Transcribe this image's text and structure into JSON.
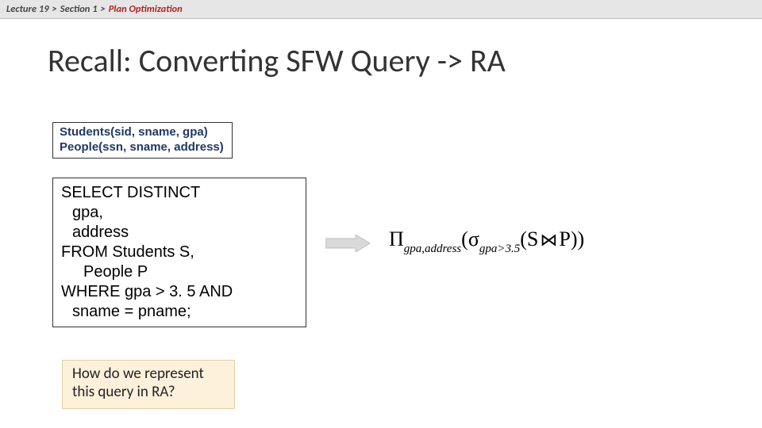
{
  "breadcrumb": {
    "part1": "Lecture 19",
    "sep1": ">",
    "part2": "Section 1",
    "sep2": ">",
    "active": "Plan Optimization"
  },
  "title": "Recall: Converting SFW Query -> RA",
  "schema": {
    "line1": "Students(sid, sname, gpa)",
    "line2": "People(ssn, sname, address)"
  },
  "sql": {
    "l1": "SELECT DISTINCT",
    "l2": "gpa,",
    "l3": "address",
    "l4": "FROM Students S,",
    "l5": "People P",
    "l6": "WHERE gpa > 3. 5 AND",
    "l7": "sname = pname;"
  },
  "question": "How do we represent this query in RA?",
  "ra": {
    "pi": "Π",
    "pi_sub": "gpa,address",
    "lparen1": "(",
    "sigma": "σ",
    "sigma_sub": "gpa>3.5",
    "lparen2": "(",
    "s": "S",
    "join": "⋈",
    "p": "P",
    "rparen2": ")",
    "rparen1": ")"
  }
}
